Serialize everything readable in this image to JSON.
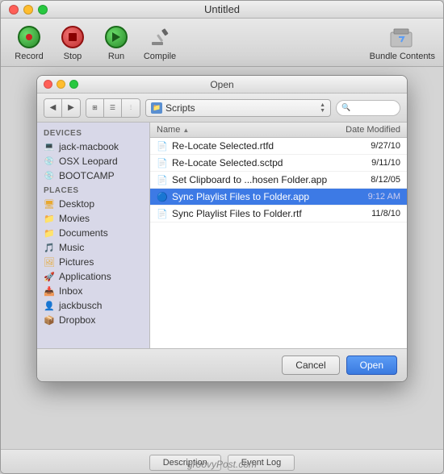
{
  "window": {
    "title": "Untitled",
    "traffic_lights": [
      "close",
      "minimize",
      "maximize"
    ]
  },
  "toolbar": {
    "record_label": "Record",
    "stop_label": "Stop",
    "run_label": "Run",
    "compile_label": "Compile",
    "bundle_label": "Bundle Contents"
  },
  "dialog": {
    "title": "Open",
    "location": "Scripts",
    "search_placeholder": "",
    "columns": {
      "name": "Name",
      "date_modified": "Date Modified"
    },
    "files": [
      {
        "name": "Re-Locate Selected.rtfd",
        "date": "9/27/10",
        "type": "rtfd",
        "selected": false
      },
      {
        "name": "Re-Locate Selected.sctpd",
        "date": "9/11/10",
        "type": "script",
        "selected": false
      },
      {
        "name": "Set Clipboard to ...hosen Folder.app",
        "date": "8/12/05",
        "type": "app",
        "selected": false
      },
      {
        "name": "Sync Playlist Files to Folder.app",
        "date": "9:12 AM",
        "type": "app",
        "selected": true
      },
      {
        "name": "Sync Playlist Files to Folder.rtf",
        "date": "11/8/10",
        "type": "rtf",
        "selected": false
      }
    ],
    "sidebar": {
      "devices_label": "DEVICES",
      "devices": [
        {
          "label": "jack-macbook",
          "icon": "disk"
        },
        {
          "label": "OSX Leopard",
          "icon": "disk"
        },
        {
          "label": "BOOTCAMP",
          "icon": "disk"
        }
      ],
      "places_label": "PLACES",
      "places": [
        {
          "label": "Desktop",
          "icon": "folder"
        },
        {
          "label": "Movies",
          "icon": "folder"
        },
        {
          "label": "Documents",
          "icon": "folder"
        },
        {
          "label": "Music",
          "icon": "music"
        },
        {
          "label": "Pictures",
          "icon": "folder"
        },
        {
          "label": "Applications",
          "icon": "app"
        },
        {
          "label": "Inbox",
          "icon": "inbox"
        },
        {
          "label": "jackbusch",
          "icon": "user"
        },
        {
          "label": "Dropbox",
          "icon": "dropbox"
        }
      ]
    },
    "cancel_label": "Cancel",
    "open_label": "Open"
  },
  "bottom_tabs": {
    "description": "Description",
    "event_log": "Event Log"
  },
  "watermark": "groovyPost.com"
}
